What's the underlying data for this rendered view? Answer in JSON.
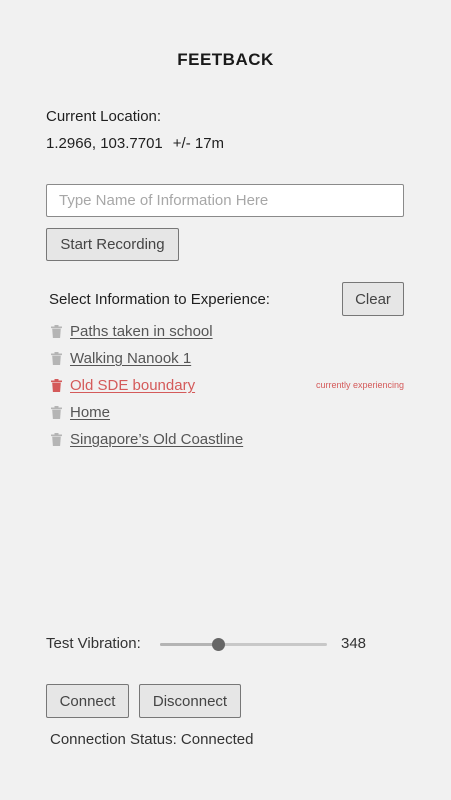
{
  "header": {
    "title": "FEETBACK"
  },
  "location": {
    "label": "Current Location:",
    "coords": "1.2966, 103.7701",
    "accuracy": "+/- 17m"
  },
  "recording": {
    "placeholder": "Type Name of Information Here",
    "value": "",
    "start_label": "Start Recording"
  },
  "experience": {
    "label": "Select Information to Experience:",
    "clear_label": "Clear",
    "items": [
      {
        "name": "Paths taken in school",
        "note": ""
      },
      {
        "name": "Walking Nanook 1",
        "note": ""
      },
      {
        "name": "Old SDE boundary",
        "note": "currently experiencing"
      },
      {
        "name": "Home",
        "note": ""
      },
      {
        "name": "Singapore’s Old Coastline",
        "note": ""
      }
    ]
  },
  "vibration": {
    "label": "Test Vibration:",
    "value": "348",
    "level_fraction": 0.35
  },
  "connection": {
    "connect_label": "Connect",
    "disconnect_label": "Disconnect",
    "status_text": "Connection Status: Connected"
  },
  "colors": {
    "active": "#d45a5a",
    "trash_inactive": "#b5b5b5"
  },
  "icons": {
    "delete": "trash-icon"
  }
}
